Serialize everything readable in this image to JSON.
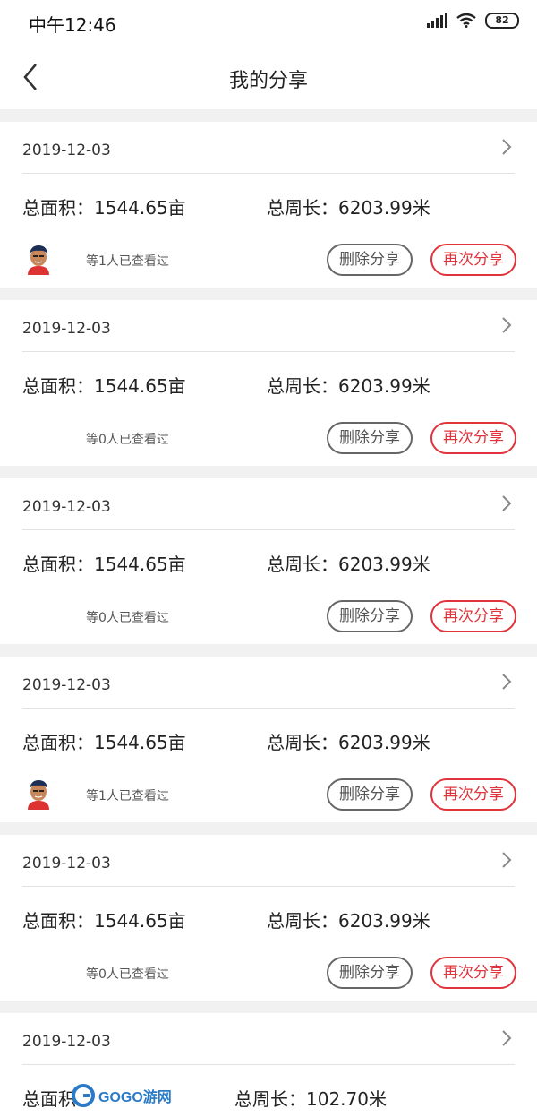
{
  "status_bar": {
    "time": "中午12:46",
    "battery": "82"
  },
  "nav": {
    "title": "我的分享"
  },
  "cards": [
    {
      "date": "2019-12-03",
      "area": "总面积：1544.65亩",
      "perimeter": "总周长：6203.99米",
      "viewed": "等1人已查看过",
      "has_avatar": true,
      "delete_label": "删除分享",
      "reshare_label": "再次分享"
    },
    {
      "date": "2019-12-03",
      "area": "总面积：1544.65亩",
      "perimeter": "总周长：6203.99米",
      "viewed": "等0人已查看过",
      "has_avatar": false,
      "delete_label": "删除分享",
      "reshare_label": "再次分享"
    },
    {
      "date": "2019-12-03",
      "area": "总面积：1544.65亩",
      "perimeter": "总周长：6203.99米",
      "viewed": "等0人已查看过",
      "has_avatar": false,
      "delete_label": "删除分享",
      "reshare_label": "再次分享"
    },
    {
      "date": "2019-12-03",
      "area": "总面积：1544.65亩",
      "perimeter": "总周长：6203.99米",
      "viewed": "等1人已查看过",
      "has_avatar": true,
      "delete_label": "删除分享",
      "reshare_label": "再次分享"
    },
    {
      "date": "2019-12-03",
      "area": "总面积：1544.65亩",
      "perimeter": "总周长：6203.99米",
      "viewed": "等0人已查看过",
      "has_avatar": false,
      "delete_label": "删除分享",
      "reshare_label": "再次分享"
    },
    {
      "date": "2019-12-03",
      "area": "总面积",
      "perimeter": "总周长：102.70米"
    }
  ],
  "watermark": {
    "text": "GOGO游网"
  },
  "colors": {
    "accent_red": "#e0333b",
    "delete_border": "#666666",
    "background": "#f1f1f1"
  }
}
